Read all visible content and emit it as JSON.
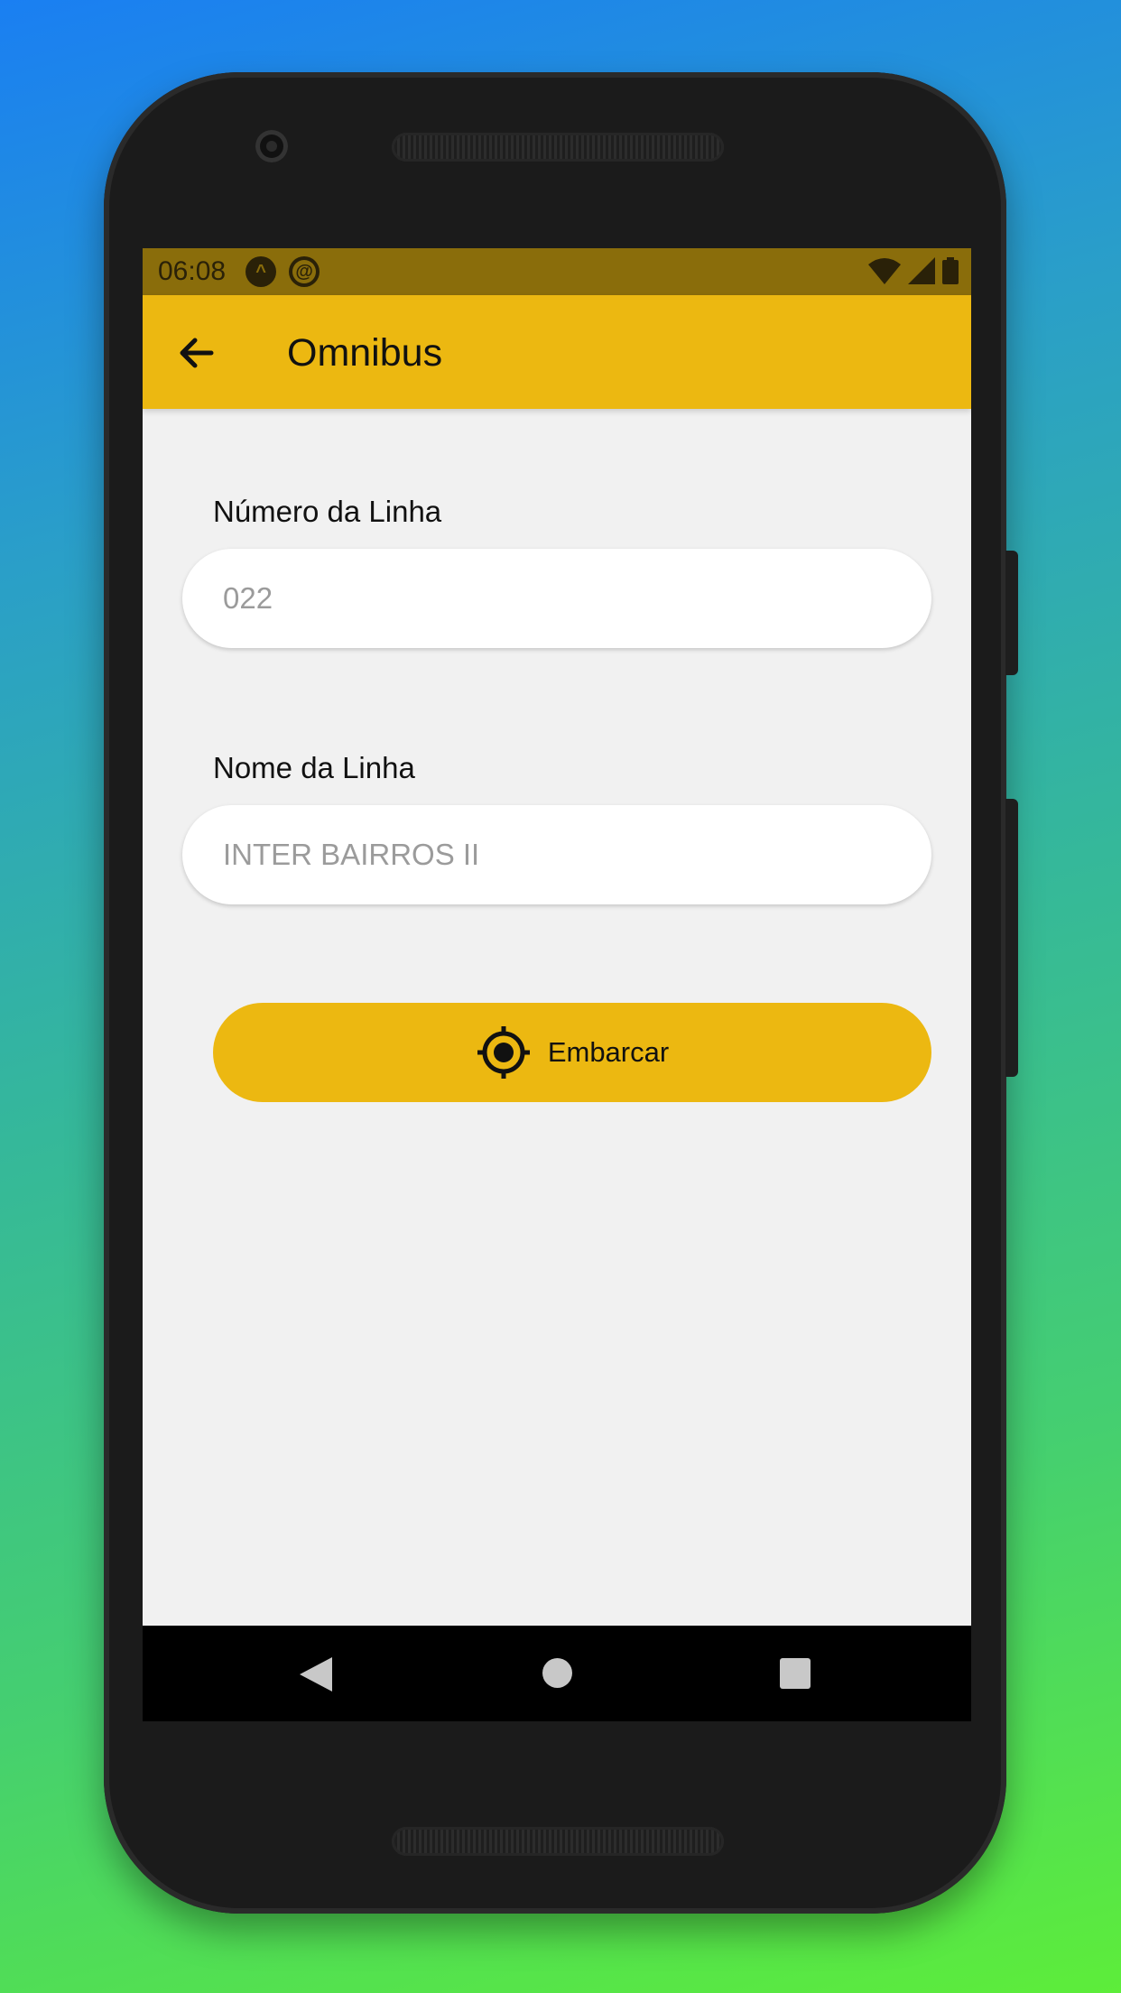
{
  "status_bar": {
    "time": "06:08",
    "notification_icons": [
      "expo-icon",
      "blocked-icon"
    ],
    "system_icons": [
      "wifi-icon",
      "cell-signal-icon",
      "battery-icon"
    ]
  },
  "app_bar": {
    "title": "Omnibus",
    "back_icon": "arrow-left-icon",
    "color": "#ecb811"
  },
  "form": {
    "line_number": {
      "label": "Número da Linha",
      "placeholder": "022",
      "value": ""
    },
    "line_name": {
      "label": "Nome da Linha",
      "placeholder": "INTER BAIRROS II",
      "value": ""
    }
  },
  "board_button": {
    "label": "Embarcar",
    "icon": "gps-fixed-icon",
    "color": "#ecb811"
  },
  "nav_bar": {
    "buttons": [
      "back",
      "home",
      "recents"
    ]
  },
  "colors": {
    "accent": "#ecb811",
    "status_bar": "#8a6d0b",
    "screen_bg": "#f1f1f1"
  }
}
